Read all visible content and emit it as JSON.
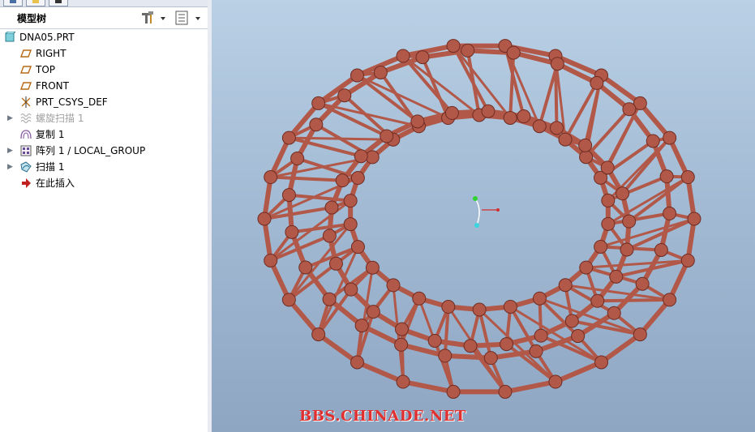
{
  "model_tree": {
    "title": "模型树",
    "items": [
      {
        "label": "DNA05.PRT",
        "icon": "part-icon",
        "expandable": false,
        "dimmed": false
      },
      {
        "label": "RIGHT",
        "icon": "datum-plane-icon",
        "expandable": false,
        "dimmed": false
      },
      {
        "label": "TOP",
        "icon": "datum-plane-icon",
        "expandable": false,
        "dimmed": false
      },
      {
        "label": "FRONT",
        "icon": "datum-plane-icon",
        "expandable": false,
        "dimmed": false
      },
      {
        "label": "PRT_CSYS_DEF",
        "icon": "csys-icon",
        "expandable": false,
        "dimmed": false
      },
      {
        "label": "螺旋扫描 1",
        "icon": "helical-sweep-icon",
        "expandable": true,
        "dimmed": true
      },
      {
        "label": "复制 1",
        "icon": "copy-icon",
        "expandable": false,
        "dimmed": false
      },
      {
        "label": "阵列 1 / LOCAL_GROUP",
        "icon": "pattern-icon",
        "expandable": true,
        "dimmed": false
      },
      {
        "label": "扫描 1",
        "icon": "sweep-icon",
        "expandable": true,
        "dimmed": false
      },
      {
        "label": "在此插入",
        "icon": "insert-here-arrow-icon",
        "expandable": false,
        "dimmed": false
      }
    ]
  },
  "viewport": {
    "watermark": "BBS.CHINADE.NET",
    "model_color": "#b25848",
    "background_top": "#b9d0e5",
    "background_bottom": "#8ea6c2"
  }
}
